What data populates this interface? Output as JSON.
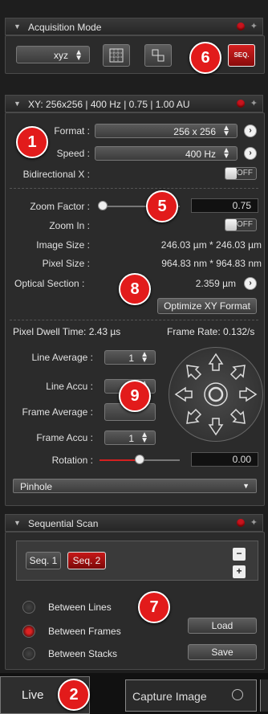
{
  "acquisition": {
    "title": "Acquisition Mode",
    "mode_value": "xyz",
    "seq_button": "SEQ."
  },
  "xy": {
    "title": "XY: 256x256 | 400 Hz | 0.75 | 1.00 AU",
    "format_label": "Format :",
    "format_value": "256 x 256",
    "speed_label": "Speed :",
    "speed_value": "400 Hz",
    "bidirectional_label": "Bidirectional X :",
    "toggle_off": "OFF",
    "zoom_factor_label": "Zoom Factor :",
    "zoom_factor_value": "0.75",
    "zoom_in_label": "Zoom In :",
    "image_size_label": "Image Size :",
    "image_size_value": "246.03 µm * 246.03 µm",
    "pixel_size_label": "Pixel Size :",
    "pixel_size_value": "964.83 nm * 964.83 nm",
    "optical_section_label": "Optical Section :",
    "optical_section_value": "2.359 µm",
    "optimize_button": "Optimize XY Format",
    "pixel_dwell": "Pixel Dwell Time: 2.43 µs",
    "frame_rate": "Frame Rate: 0.132/s",
    "line_average_label": "Line Average :",
    "line_average_value": "1",
    "line_accu_label": "Line Accu :",
    "frame_average_label": "Frame Average :",
    "frame_accu_label": "Frame Accu :",
    "frame_accu_value": "1",
    "rotation_label": "Rotation :",
    "rotation_value": "0.00",
    "pinhole_label": "Pinhole"
  },
  "sequential": {
    "title": "Sequential Scan",
    "seq1": "Seq. 1",
    "seq2": "Seq. 2",
    "between_lines": "Between Lines",
    "between_frames": "Between Frames",
    "between_stacks": "Between Stacks",
    "load": "Load",
    "save": "Save"
  },
  "bottom": {
    "live": "Live",
    "capture": "Capture Image"
  },
  "badges": {
    "b1": "1",
    "b2": "2",
    "b5": "5",
    "b6": "6",
    "b7": "7",
    "b8": "8",
    "b9": "9"
  }
}
